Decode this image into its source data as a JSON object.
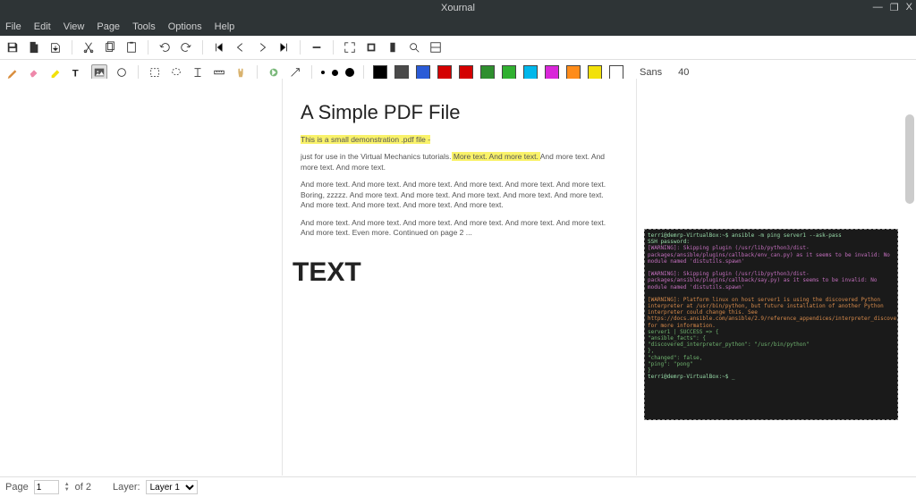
{
  "app": {
    "title": "Xournal"
  },
  "menu": [
    "File",
    "Edit",
    "View",
    "Page",
    "Tools",
    "Options",
    "Help"
  ],
  "window_controls": {
    "min": "—",
    "max": "❐",
    "close": "X"
  },
  "toolbar1": {
    "save": "save-icon",
    "new": "new-icon",
    "open": "open-icon",
    "cut": "cut-icon",
    "copy": "copy-icon",
    "paste": "paste-icon",
    "undo": "undo-icon",
    "redo": "redo-icon",
    "first": "first-page-icon",
    "prev": "prev-page-icon",
    "next": "next-page-icon",
    "last": "last-page-icon",
    "zoomout": "zoom-out-icon",
    "fullscreen": "fullscreen-icon",
    "zoomfit": "zoom-fit-icon",
    "zoompage": "zoom-page-icon",
    "zoomin": "zoom-in-icon",
    "toggle": "toggle-icon"
  },
  "toolbar2": {
    "pen": "pen-tool",
    "eraser": "eraser-tool",
    "highlighter": "highlighter-tool",
    "texttool": "text-tool",
    "image": "image-tool",
    "shape": "shape-tool",
    "select-rect": "select-rect-tool",
    "select-lasso": "select-lasso-tool",
    "vspace": "vspace-tool",
    "ruler": "ruler-tool",
    "hand": "hand-tool",
    "default": "default-tool",
    "arrow": "arrow-tool",
    "thickness": [
      "fine",
      "medium",
      "thick"
    ],
    "colors": [
      "#000000",
      "#4a4a4a",
      "#2a5bd7",
      "#d40000",
      "#d40000",
      "#2e8f2e",
      "#30b030",
      "#00b7eb",
      "#d926d9",
      "#ff8c1a",
      "#f2e10a",
      "#ffffff"
    ],
    "font_name": "Sans",
    "font_size": "40"
  },
  "document": {
    "title": "A Simple PDF File",
    "p1": "This is a small demonstration .pdf file -",
    "p2a": "just for use in the Virtual Mechanics tutorials.",
    "p2b": " More text. And more text. ",
    "p2c": "And more text. And more text. And more text.",
    "p3": "And more text. And more text. And more text. And more text. And more text. And more text. Boring, zzzzz. And more text. And more text. And more text. And more text. And more text. And more text. And more text. And more text. And more text.",
    "p4": "And more text. And more text. And more text. And more text. And more text. And more text. And more text. Even more. Continued on page 2 ...",
    "annot": "TEXT",
    "terminal": {
      "l1": "terri@demrp-VirtualBox:~$ ansible -m ping server1 --ask-pass",
      "l2": "SSH password:",
      "l3": "[WARNING]: Skipping plugin (/usr/lib/python3/dist-packages/ansible/plugins/callback/env_can.py) as it seems to be invalid: No module named 'distutils.spawn'",
      "l4": "[WARNING]: Skipping plugin (/usr/lib/python3/dist-packages/ansible/plugins/callback/say.py) as it seems to be invalid: No module named 'distutils.spawn'",
      "l5": "[WARNING]: Platform linux on host server1 is using the discovered Python interpreter at /usr/bin/python, but future installation of another Python interpreter could change this. See https://docs.ansible.com/ansible/2.9/reference_appendices/interpreter_discovery.html for more information.",
      "l6": "server1 | SUCCESS => {",
      "l7": "    \"ansible_facts\": {",
      "l8": "        \"discovered_interpreter_python\": \"/usr/bin/python\"",
      "l9": "    },",
      "l10": "    \"changed\": false,",
      "l11": "    \"ping\": \"pong\"",
      "l12": "}",
      "l13": "terri@demrp-VirtualBox:~$ _"
    }
  },
  "status": {
    "page_label": "Page",
    "page_current": "1",
    "page_of": "of 2",
    "layer_label": "Layer:",
    "layer_value": "Layer 1"
  }
}
